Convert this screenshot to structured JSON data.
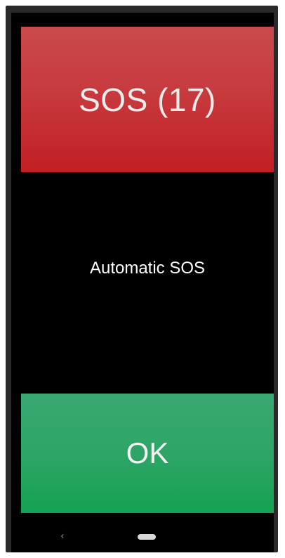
{
  "screen": {
    "sos_button_label": "SOS (17)",
    "message": "Automatic SOS",
    "ok_button_label": "OK"
  },
  "nav": {
    "back_glyph": "‹",
    "back_icon": "back-icon",
    "home_icon": "home-pill-icon"
  },
  "colors": {
    "sos_red": "#c73a3e",
    "ok_green": "#2ea566",
    "background": "#000000"
  }
}
